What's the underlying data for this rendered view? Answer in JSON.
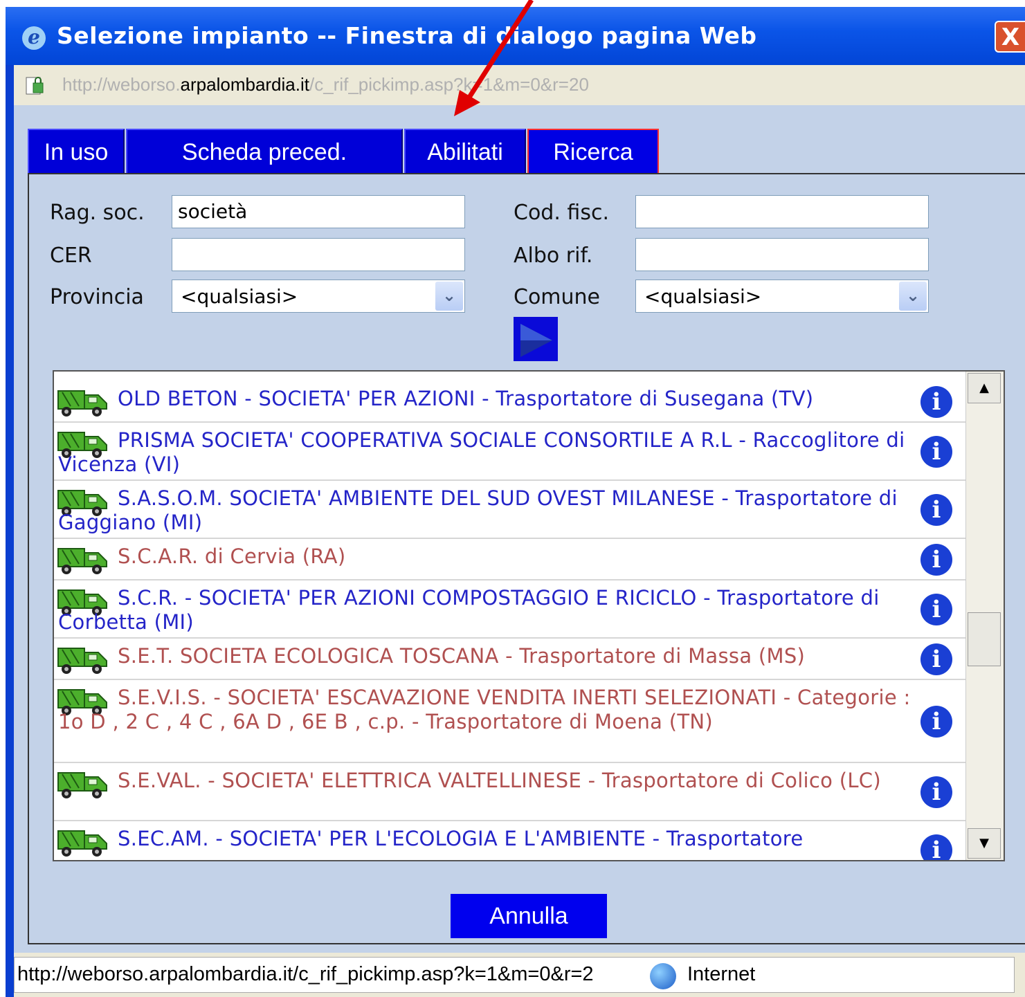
{
  "window": {
    "title": "Selezione impianto -- Finestra di dialogo pagina Web",
    "close_label": "X",
    "address_prefix": "http://weborso.",
    "address_domain": "arpalombardia.it",
    "address_suffix": "/c_rif_pickimp.asp?k=1&m=0&r=20"
  },
  "tabs": [
    {
      "label": "In uso"
    },
    {
      "label": "Scheda preced."
    },
    {
      "label": "Abilitati"
    },
    {
      "label": "Ricerca"
    }
  ],
  "form": {
    "ragsoc_label": "Rag. soc.",
    "ragsoc_value": "società",
    "codfisc_label": "Cod. fisc.",
    "codfisc_value": "",
    "cer_label": "CER",
    "cer_value": "",
    "albo_label": "Albo rif.",
    "albo_value": "",
    "provincia_label": "Provincia",
    "provincia_value": "<qualsiasi>",
    "comune_label": "Comune",
    "comune_value": "<qualsiasi>"
  },
  "results": [
    {
      "text": "OLD BETON - SOCIETA' PER AZIONI - Trasportatore di Susegana (TV)",
      "color": "#2424c8"
    },
    {
      "text": "PRISMA SOCIETA' COOPERATIVA SOCIALE CONSORTILE A R.L - Raccoglitore di Vicenza (VI)",
      "color": "#2424c8"
    },
    {
      "text": "S.A.S.O.M. SOCIETA' AMBIENTE DEL SUD OVEST MILANESE - Trasportatore di Gaggiano (MI)",
      "color": "#2424c8"
    },
    {
      "text": "S.C.A.R. di Cervia (RA)",
      "color": "#b05050"
    },
    {
      "text": "S.C.R. - SOCIETA' PER AZIONI COMPOSTAGGIO E RICICLO - Trasportatore di Corbetta (MI)",
      "color": "#2424c8"
    },
    {
      "text": "S.E.T. SOCIETA ECOLOGICA TOSCANA - Trasportatore di Massa (MS)",
      "color": "#b05050"
    },
    {
      "text": "S.E.V.I.S. - SOCIETA' ESCAVAZIONE VENDITA INERTI SELEZIONATI - Categorie : 1o D , 2 C , 4 C , 6A D , 6E B , c.p. - Trasportatore di Moena (TN)",
      "color": "#b05050"
    },
    {
      "text": "S.E.VAL. - SOCIETA' ELETTRICA VALTELLINESE - Trasportatore di Colico (LC)",
      "color": "#b05050"
    },
    {
      "text": "S.EC.AM. - SOCIETA' PER L'ECOLOGIA E L'AMBIENTE - Trasportatore",
      "color": "#2424c8"
    }
  ],
  "buttons": {
    "cancel_label": "Annulla"
  },
  "status": {
    "url": "http://weborso.arpalombardia.it/c_rif_pickimp.asp?k=1&m=0&r=2",
    "zone": "Internet"
  }
}
